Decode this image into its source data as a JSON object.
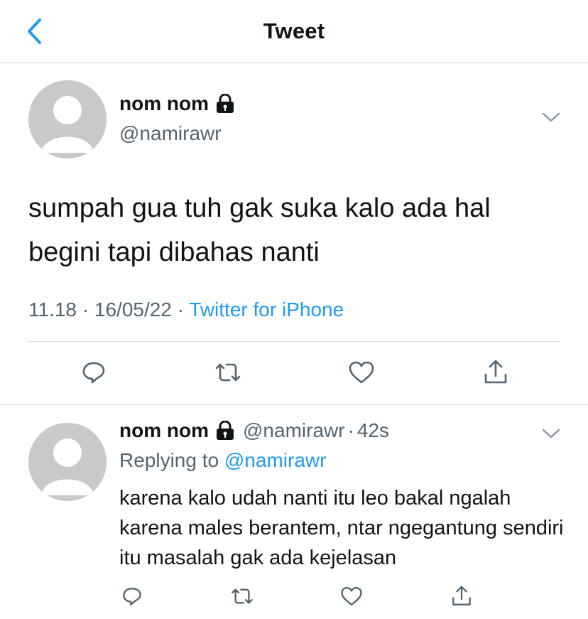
{
  "header": {
    "title": "Tweet",
    "back_icon": "chevron-left-icon"
  },
  "tweet": {
    "name": "nom nom",
    "handle": "@namirawr",
    "text": "sumpah gua tuh gak suka kalo ada hal begini tapi dibahas nanti",
    "time": "11.18",
    "date": "16/05/22",
    "separator": "·",
    "source": "Twitter for iPhone"
  },
  "reply": {
    "name": "nom nom",
    "handle": "@namirawr",
    "separator": "·",
    "age": "42s",
    "replying_prefix": "Replying to",
    "replying_to": "@namirawr",
    "text": "karena kalo udah nanti itu leo bakal ngalah karena males berantem, ntar ngegantung sendiri itu masalah gak ada kejelasan"
  },
  "colors": {
    "accent": "#1d9bf0",
    "muted": "#536471",
    "text": "#0f1419",
    "border": "#d7dbde",
    "avatar": "#c9c9c9"
  }
}
